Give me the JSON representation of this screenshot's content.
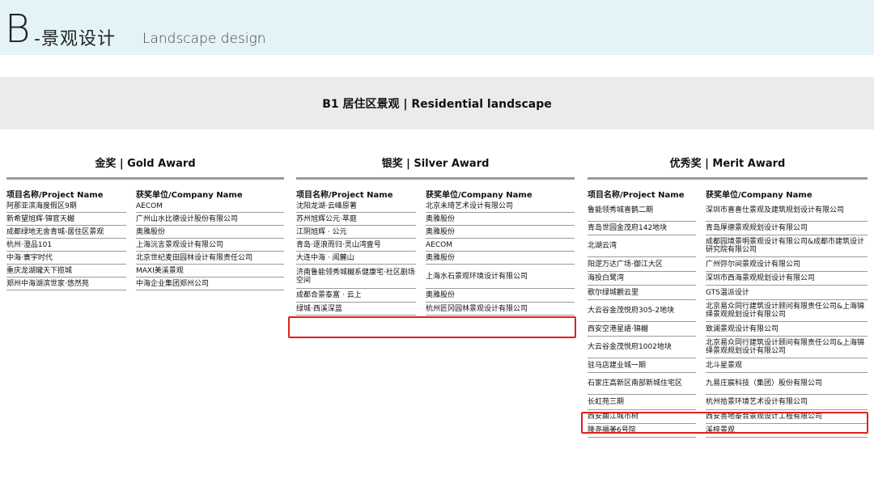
{
  "header": {
    "letter": "B",
    "title_zh": "-景观设计",
    "title_en": "Landscape design"
  },
  "category": {
    "title": "B1 居住区景观 | Residential landscape"
  },
  "columns": [
    {
      "title": "金奖 | Gold Award",
      "project_header": "项目名称/Project Name",
      "company_header": "获奖单位/Company Name",
      "rows": [
        {
          "project": "阿那亚滨海度假区9期",
          "company": "AECOM"
        },
        {
          "project": "新希望旭辉·锦官天樾",
          "company": "广州山水比德设计股份有限公司"
        },
        {
          "project": "成都绿地无舍青城-居住区景观",
          "company": "奥雅股份"
        },
        {
          "project": "杭州·澄品101",
          "company": "上海沅言景观设计有限公司"
        },
        {
          "project": "中海·寰宇时代",
          "company": "北京世纪麦田园林设计有限责任公司"
        },
        {
          "project": "重庆龙湖瓏天下揽城",
          "company": "MAXI美溪景观"
        },
        {
          "project": "郑州中海湖滨世家·悠然苑",
          "company": "中海企业集团郑州公司"
        }
      ]
    },
    {
      "title": "银奖 | Silver Award",
      "project_header": "项目名称/Project Name",
      "company_header": "获奖单位/Company Name",
      "rows": [
        {
          "project": "沈阳龙湖·云峰原著",
          "company": "北京未琦艺术设计有限公司"
        },
        {
          "project": "苏州旭辉公元·萃庭",
          "company": "奥雅股份"
        },
        {
          "project": "江阴旭辉 · 公元",
          "company": "奥雅股份"
        },
        {
          "project": "青岛·逐浪而归·灵山湾壹号",
          "company": "AECOM"
        },
        {
          "project": "大连中海 · 阅麓山",
          "company": "奥雅股份"
        },
        {
          "project": "济南鲁能领秀城樾系健康宅·社区剧场空间",
          "company": "上海水石景观环境设计有限公司"
        },
        {
          "project": "成都合景泰富 · 云上",
          "company": "奥雅股份"
        },
        {
          "project": "绿城·西溪深蓝",
          "company": "杭州匠冈园林景观设计有限公司"
        }
      ]
    },
    {
      "title": "优秀奖 | Merit Award",
      "project_header": "项目名称/Project Name",
      "company_header": "获奖单位/Company Name",
      "rows": [
        {
          "project": "鲁能领秀城喜鹊二期",
          "company": "深圳市喜喜仕景观及建筑规划设计有限公司"
        },
        {
          "project": "青岛世园金茂府142地块",
          "company": "青岛厚德景观规划设计有限公司"
        },
        {
          "project": "北湖云湾",
          "company": "成都园境景明景观设计有限公司&成都市建筑设计研究院有限公司"
        },
        {
          "project": "阳逻万达广场·御江大区",
          "company": "广州弥尔间景观设计有限公司"
        },
        {
          "project": "海投白鹭湾",
          "company": "深圳市西海景观规划设计有限公司"
        },
        {
          "project": "歌尔绿城觀云里",
          "company": "GTS温派设计"
        },
        {
          "project": "大云谷金茂悦府305-2地块",
          "company": "北京易众同行建筑设计顾问有限责任公司&上海锦绎景观规划设计有限公司"
        },
        {
          "project": "西安空港星語·锦樾",
          "company": "致澜景观设计有限公司"
        },
        {
          "project": "大云谷金茂悦府1002地块",
          "company": "北京易众同行建筑设计顾问有限责任公司&上海锦绎景观规划设计有限公司"
        },
        {
          "project": "驻马店建业城一期",
          "company": "北斗星景观"
        },
        {
          "project": "石家庄高新区南部新城住宅区",
          "company": "九易庄宸科技（集团）股份有限公司"
        },
        {
          "project": "长虹苑三期",
          "company": "杭州拾景环境艺术设计有限公司"
        },
        {
          "project": "西安曲江城市树",
          "company": "西安善地泰合景观设计工程有限公司"
        },
        {
          "project": "隆尧福美6号院",
          "company": "溪梓景观"
        }
      ]
    }
  ]
}
